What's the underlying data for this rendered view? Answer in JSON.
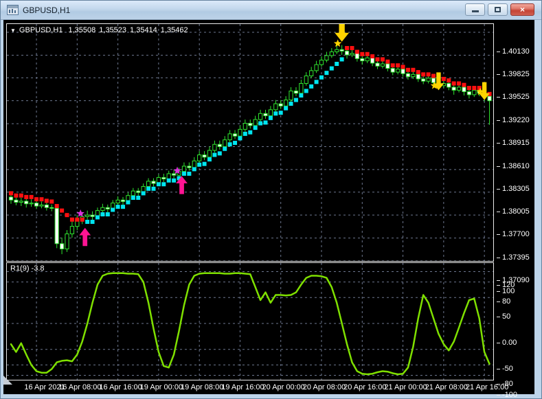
{
  "window": {
    "title": "GBPUSD,H1",
    "close_glyph": "×"
  },
  "main_header": {
    "marker": "▼",
    "symbol": "GBPUSD,H1",
    "open": "1,35508",
    "high": "1,35523",
    "low": "1,35414",
    "close": "1,35462"
  },
  "colors": {
    "background": "#000000",
    "grid": "#6e7890",
    "candle_outline": "#2fe62f",
    "bull_body": "#000000",
    "bear_body": "#ffffff",
    "trend_up": "#00e5f0",
    "trend_down": "#ff1010",
    "buy_arrow": "#ff1493",
    "buy_star": "#dd33dd",
    "sell_arrow": "#ffd400",
    "sell_star": "#ffd400",
    "oscillator_line": "#7fe000",
    "axis_text": "#ffffff",
    "panel_border": "#ececec"
  },
  "chart_data": [
    {
      "type": "candlestick",
      "title": "GBPUSD,H1",
      "timeframe": "H1",
      "price_ticks": [
        1.4013,
        1.39825,
        1.39525,
        1.3922,
        1.38915,
        1.3861,
        1.38305,
        1.38005,
        1.377,
        1.37395,
        1.3709
      ],
      "x_labels": [
        "16 Apr 2021",
        "16 Apr 08:00",
        "16 Apr 16:00",
        "19 Apr 00:00",
        "19 Apr 08:00",
        "19 Apr 16:00",
        "20 Apr 00:00",
        "20 Apr 08:00",
        "20 Apr 16:00",
        "21 Apr 00:00",
        "21 Apr 08:00",
        "21 Apr 16:00"
      ],
      "first_gridline_bar": 5,
      "bars_per_gridline": 8,
      "candles": [
        [
          1.3794,
          1.3799,
          1.3785,
          1.379
        ],
        [
          1.379,
          1.3795,
          1.3783,
          1.3787
        ],
        [
          1.3787,
          1.3793,
          1.3782,
          1.37885
        ],
        [
          1.37885,
          1.3792,
          1.378,
          1.3785
        ],
        [
          1.3785,
          1.3791,
          1.3781,
          1.3786
        ],
        [
          1.3786,
          1.379,
          1.3778,
          1.3782
        ],
        [
          1.3782,
          1.3788,
          1.3779,
          1.37835
        ],
        [
          1.37835,
          1.3787,
          1.3776,
          1.378
        ],
        [
          1.378,
          1.3784,
          1.3775,
          1.3779
        ],
        [
          1.3779,
          1.3781,
          1.3726,
          1.3732
        ],
        [
          1.3732,
          1.374,
          1.3718,
          1.3725
        ],
        [
          1.3725,
          1.375,
          1.3721,
          1.3745
        ],
        [
          1.3745,
          1.3762,
          1.374,
          1.3755
        ],
        [
          1.3755,
          1.377,
          1.375,
          1.3764
        ],
        [
          1.3764,
          1.3774,
          1.3758,
          1.3768
        ],
        [
          1.3768,
          1.3776,
          1.3764,
          1.377
        ],
        [
          1.377,
          1.3775,
          1.3762,
          1.3768
        ],
        [
          1.3768,
          1.378,
          1.3765,
          1.3776
        ],
        [
          1.3776,
          1.3785,
          1.3772,
          1.378
        ],
        [
          1.378,
          1.3784,
          1.3773,
          1.3778
        ],
        [
          1.3778,
          1.379,
          1.3775,
          1.3786
        ],
        [
          1.3786,
          1.3795,
          1.3782,
          1.379
        ],
        [
          1.379,
          1.3794,
          1.3783,
          1.3788
        ],
        [
          1.3788,
          1.38,
          1.3785,
          1.3796
        ],
        [
          1.3796,
          1.3806,
          1.3792,
          1.3802
        ],
        [
          1.3802,
          1.3806,
          1.3795,
          1.38
        ],
        [
          1.38,
          1.3812,
          1.3797,
          1.3808
        ],
        [
          1.3808,
          1.3819,
          1.3804,
          1.3815
        ],
        [
          1.3815,
          1.3819,
          1.3808,
          1.3812
        ],
        [
          1.3812,
          1.3824,
          1.3809,
          1.382
        ],
        [
          1.382,
          1.3825,
          1.3814,
          1.3818
        ],
        [
          1.3818,
          1.3829,
          1.3815,
          1.3825
        ],
        [
          1.3825,
          1.383,
          1.3819,
          1.3823
        ],
        [
          1.3823,
          1.3833,
          1.3819,
          1.3828
        ],
        [
          1.3828,
          1.384,
          1.3824,
          1.3835
        ],
        [
          1.3835,
          1.384,
          1.3829,
          1.3833
        ],
        [
          1.3833,
          1.3847,
          1.383,
          1.3842
        ],
        [
          1.3842,
          1.3855,
          1.3839,
          1.385
        ],
        [
          1.385,
          1.3855,
          1.3843,
          1.3847
        ],
        [
          1.3847,
          1.3861,
          1.3844,
          1.3856
        ],
        [
          1.3856,
          1.3869,
          1.3853,
          1.3864
        ],
        [
          1.3864,
          1.3869,
          1.3857,
          1.3861
        ],
        [
          1.3861,
          1.3875,
          1.3858,
          1.387
        ],
        [
          1.387,
          1.3883,
          1.3867,
          1.3878
        ],
        [
          1.3878,
          1.3883,
          1.3871,
          1.3875
        ],
        [
          1.3875,
          1.3889,
          1.3872,
          1.3884
        ],
        [
          1.3884,
          1.3897,
          1.3881,
          1.3892
        ],
        [
          1.3892,
          1.3897,
          1.3885,
          1.3889
        ],
        [
          1.3889,
          1.3902,
          1.3886,
          1.3897
        ],
        [
          1.3897,
          1.391,
          1.3894,
          1.3905
        ],
        [
          1.3905,
          1.391,
          1.3898,
          1.3902
        ],
        [
          1.3902,
          1.3915,
          1.3899,
          1.391
        ],
        [
          1.391,
          1.3923,
          1.3907,
          1.3918
        ],
        [
          1.3918,
          1.3923,
          1.3911,
          1.3915
        ],
        [
          1.3915,
          1.3928,
          1.3912,
          1.3923
        ],
        [
          1.3923,
          1.394,
          1.392,
          1.3935
        ],
        [
          1.3935,
          1.394,
          1.3928,
          1.3932
        ],
        [
          1.3932,
          1.395,
          1.3929,
          1.3945
        ],
        [
          1.3945,
          1.396,
          1.3942,
          1.3955
        ],
        [
          1.3955,
          1.3967,
          1.3952,
          1.3962
        ],
        [
          1.3962,
          1.3975,
          1.3959,
          1.397
        ],
        [
          1.397,
          1.3981,
          1.3967,
          1.3976
        ],
        [
          1.3976,
          1.3987,
          1.3973,
          1.3982
        ],
        [
          1.3982,
          1.3992,
          1.3979,
          1.3987
        ],
        [
          1.3987,
          1.3995,
          1.3984,
          1.399
        ],
        [
          1.399,
          1.3996,
          1.3983,
          1.3988
        ],
        [
          1.3988,
          1.3993,
          1.3978,
          1.3983
        ],
        [
          1.3983,
          1.399,
          1.398,
          1.3985
        ],
        [
          1.3985,
          1.3988,
          1.3974,
          1.3978
        ],
        [
          1.3978,
          1.3983,
          1.397,
          1.3975
        ],
        [
          1.3975,
          1.3984,
          1.3972,
          1.3979
        ],
        [
          1.3979,
          1.3982,
          1.3968,
          1.3972
        ],
        [
          1.3972,
          1.3977,
          1.3964,
          1.3968
        ],
        [
          1.3968,
          1.3976,
          1.3965,
          1.3971
        ],
        [
          1.3971,
          1.3974,
          1.3961,
          1.3965
        ],
        [
          1.3965,
          1.397,
          1.3956,
          1.396
        ],
        [
          1.396,
          1.3969,
          1.3957,
          1.3964
        ],
        [
          1.3964,
          1.3967,
          1.3954,
          1.3958
        ],
        [
          1.3958,
          1.3962,
          1.395,
          1.3954
        ],
        [
          1.3954,
          1.3962,
          1.3951,
          1.3957
        ],
        [
          1.3957,
          1.396,
          1.3947,
          1.3951
        ],
        [
          1.3951,
          1.3956,
          1.3944,
          1.3948
        ],
        [
          1.3948,
          1.3957,
          1.3945,
          1.3952
        ],
        [
          1.3952,
          1.3955,
          1.3942,
          1.3946
        ],
        [
          1.3946,
          1.395,
          1.3938,
          1.3942
        ],
        [
          1.3942,
          1.395,
          1.3939,
          1.3945
        ],
        [
          1.3945,
          1.3948,
          1.3936,
          1.394
        ],
        [
          1.394,
          1.3944,
          1.393,
          1.3936
        ],
        [
          1.3936,
          1.3945,
          1.3933,
          1.394
        ],
        [
          1.394,
          1.3943,
          1.3929,
          1.3934
        ],
        [
          1.3934,
          1.3938,
          1.3925,
          1.393
        ],
        [
          1.393,
          1.3941,
          1.3927,
          1.3936
        ],
        [
          1.3936,
          1.3939,
          1.3928,
          1.3932
        ],
        [
          1.3932,
          1.3936,
          1.3921,
          1.3928
        ],
        [
          1.3928,
          1.3931,
          1.389,
          1.3922
        ]
      ],
      "trend_indicator": {
        "offset": 0.0009,
        "max_step_per_bar": 0.0006,
        "segments": [
          {
            "start": 0,
            "end": 14,
            "direction": "down"
          },
          {
            "start": 15,
            "end": 65,
            "direction": "up"
          },
          {
            "start": 66,
            "end": 94,
            "direction": "down"
          }
        ]
      },
      "signals": {
        "buy": [
          {
            "bar": 14,
            "star_price": 1.3772,
            "arrow_tip_price": 1.3753,
            "scale": 1.2
          },
          {
            "bar": 33,
            "star_price": 1.3829,
            "arrow_tip_price": 1.3822,
            "scale": 1.2
          }
        ],
        "sell": [
          {
            "bar": 65,
            "star_price": 1.3998,
            "arrow_tip_price": 1.40005,
            "scale": 1.3
          },
          {
            "bar": 84,
            "star_price": 1.3942,
            "arrow_tip_price": 1.3936,
            "scale": 1.0
          },
          {
            "bar": 93,
            "star_price": 1.3934,
            "arrow_tip_price": 1.3923,
            "scale": 1.0
          }
        ]
      }
    },
    {
      "type": "line",
      "name": "R1",
      "period": 9,
      "current_value": -3.8,
      "label": "R1(9) -3.8",
      "axis_ticks": [
        "120",
        "100",
        "80",
        "50",
        "0.00",
        "-50",
        "-80",
        "-100"
      ],
      "levels": [
        100,
        80,
        50,
        0,
        -50,
        -80,
        -100
      ],
      "ylim": [
        -115,
        115
      ],
      "values": [
        -40,
        -55,
        -38,
        -60,
        -80,
        -92,
        -95,
        -95,
        -88,
        -75,
        -72,
        -71,
        -73,
        -60,
        -35,
        0,
        40,
        75,
        92,
        96,
        97,
        97,
        97,
        96,
        96,
        95,
        80,
        40,
        -10,
        -55,
        -82,
        -85,
        -60,
        -15,
        35,
        75,
        92,
        96,
        97,
        97,
        97,
        97,
        96,
        96,
        97,
        97,
        96,
        95,
        70,
        45,
        60,
        40,
        55,
        55,
        54,
        55,
        60,
        75,
        88,
        92,
        92,
        91,
        88,
        70,
        40,
        0,
        -40,
        -75,
        -92,
        -97,
        -98,
        -97,
        -94,
        -92,
        -93,
        -96,
        -98,
        -97,
        -85,
        -45,
        10,
        55,
        40,
        10,
        -20,
        -40,
        -52,
        -35,
        -8,
        20,
        45,
        48,
        10,
        -55,
        -78
      ]
    }
  ]
}
